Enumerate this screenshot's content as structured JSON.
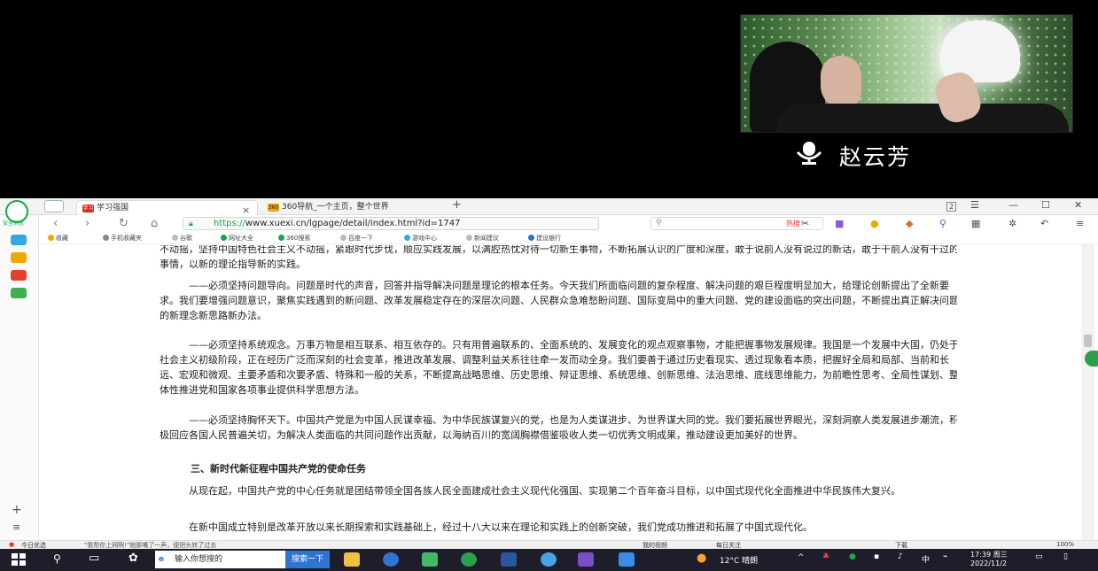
{
  "video": {
    "speaker_name": "赵云芳"
  },
  "browser": {
    "logo_sub": "安全浏览",
    "tabs": [
      {
        "label": "学习强国",
        "icon_text": "学习",
        "active": true
      },
      {
        "label": "360导航_一个主页，整个世界",
        "icon_text": "360",
        "active": false
      }
    ],
    "tab_badge": "2",
    "url_protocol": "https://",
    "url_rest": "www.xuexi.cn/lgpage/detail/index.html?id=1747",
    "hot_search": "热搜",
    "bookmarks": [
      "收藏",
      "手机收藏夹",
      "谷歌",
      "网址大全",
      "360搜索",
      "百度一下",
      "游戏中心",
      "新闻建议",
      "建设银行"
    ],
    "content": {
      "p1": "不动摇，坚持中国特色社会主义不动摇，紧跟时代步伐，顺应实践发展，以满腔热忱对待一切新生事物，不断拓展认识的广度和深度，敢于说前人没有说过的新话，敢于干前人没有干过的事情，以新的理论指导新的实践。",
      "p2": "——必须坚持问题导向。问题是时代的声音，回答并指导解决问题是理论的根本任务。今天我们所面临问题的复杂程度、解决问题的艰巨程度明显加大，给理论创新提出了全新要求。我们要增强问题意识，聚焦实践遇到的新问题、改革发展稳定存在的深层次问题、人民群众急难愁盼问题、国际变局中的重大问题、党的建设面临的突出问题，不断提出真正解决问题的新理念新思路新办法。",
      "p3": "——必须坚持系统观念。万事万物是相互联系、相互依存的。只有用普遍联系的、全面系统的、发展变化的观点观察事物，才能把握事物发展规律。我国是一个发展中大国，仍处于社会主义初级阶段，正在经历广泛而深刻的社会变革，推进改革发展、调整利益关系往往牵一发而动全身。我们要善于通过历史看现实、透过现象看本质，把握好全局和局部、当前和长远、宏观和微观、主要矛盾和次要矛盾、特殊和一般的关系，不断提高战略思维、历史思维、辩证思维、系统思维、创新思维、法治思维、底线思维能力，为前瞻性思考、全局性谋划、整体性推进党和国家各项事业提供科学思想方法。",
      "p4": "——必须坚持胸怀天下。中国共产党是为中国人民谋幸福、为中华民族谋复兴的党，也是为人类谋进步、为世界谋大同的党。我们要拓展世界眼光，深刻洞察人类发展进步潮流，积极回应各国人民普遍关切，为解决人类面临的共同问题作出贡献，以海纳百川的宽阔胸襟借鉴吸收人类一切优秀文明成果，推动建设更加美好的世界。",
      "heading": "三、新时代新征程中国共产党的使命任务",
      "p5": "从现在起，中国共产党的中心任务就是团结带领全国各族人民全面建成社会主义现代化强国、实现第二个百年奋斗目标，以中国式现代化全面推进中华民族伟大复兴。",
      "p6": "在新中国成立特别是改革开放以来长期探索和实践基础上，经过十八大以来在理论和实践上的创新突破，我们党成功推进和拓展了中国式现代化。"
    },
    "status": {
      "left": "今日优选",
      "news": "\"我帮你上网啊!\"她那嘴了一声，便把头转了过去",
      "mid": "我的视频",
      "attention": "每日关注",
      "download": "下载",
      "zoom": "100%"
    }
  },
  "taskbar": {
    "search_placeholder": "输入你想搜的",
    "search_button": "搜索一下",
    "weather": "12°C 晴朗",
    "ime": "中",
    "time": "17:39 周三",
    "date": "2022/11/2"
  }
}
